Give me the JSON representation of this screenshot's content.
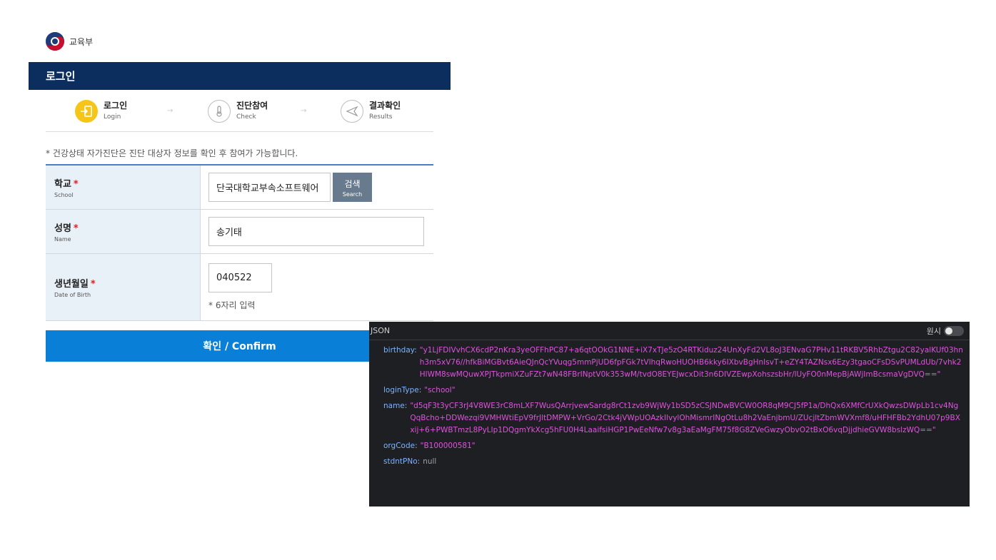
{
  "ministry": {
    "name": "교육부"
  },
  "header": {
    "title": "로그인"
  },
  "steps": [
    {
      "label": "로그인",
      "sub": "Login",
      "icon": "login-icon",
      "active": true
    },
    {
      "label": "진단참여",
      "sub": "Check",
      "icon": "thermometer-icon",
      "active": false
    },
    {
      "label": "결과확인",
      "sub": "Results",
      "icon": "send-icon",
      "active": false
    }
  ],
  "step_arrow": "→",
  "notice": "* 건강상태 자가진단은 진단 대상자 정보를 확인 후 참여가 가능합니다.",
  "form": {
    "school": {
      "label": "학교",
      "sub": "School",
      "required": "*",
      "value": "단국대학교부속소프트웨어"
    },
    "search_button": {
      "label": "검색",
      "sub": "Search"
    },
    "name": {
      "label": "성명",
      "sub": "Name",
      "required": "*",
      "value": "송기태"
    },
    "birth": {
      "label": "생년월일",
      "sub": "Date of Birth",
      "required": "*",
      "value": "040522",
      "hint": "* 6자리 입력"
    }
  },
  "confirm_button": "확인 / Confirm",
  "devtools": {
    "title": "JSON",
    "raw_label": "원시",
    "raw_enabled": false,
    "fields": [
      {
        "key": "birthday:",
        "value": "\"y1LjFDIVvhCX6cdP2nKra3yeOFFhPC87+a6qtOOkG1NNE+iX7xTJe5zO4RTKiduz24UnXyFd2VL8oJ3ENvaG7PHv11tRKBV5RhbZtgu2C82yalKUf03hnh3m5xV76//hfkBiMGBvt6AieQJnQcYVuqg5mmPjUD6fpFGk7tVlhqRwoHUOHB6kky6IXbvBgHnIsvT+eZY4TAZNsx6Ezy3tgaoCFsDSvPUMLdUb/7vhk2HlWM8swMQuwXPJTkpmiXZuFZt7wN48FBrINptV0k353wM/tvdO8EYEJwcxDit3n6DIVZEwpXohszsbHr/lUyFO0nMepBjAWjImBcsmaVgDVQ==\""
      },
      {
        "key": "loginType:",
        "value": "\"school\""
      },
      {
        "key": "name:",
        "value": "\"d5qF3t3yCF3rJ4V8WE3rC8mLXF7WusQArrjvewSardg8rCt1zvb9WjWy1bSD5zCSJNDwBVCW0OR8qM9CJ5fP1a/DhQx6XMfCrUXkQwzsDWpLb1cv4NgQqBcho+DDWezqi9VMHWtiEpV9frJltDMPW+VrGo/2Ctk4jVWpUOAzkIlvylOhMismrINgOtLu8h2VaEnjbmU/ZUcjltZbmWVXmf8/uHFHFBb2YdhU07p9BXxij+6+PWBTmzL8PyLlp1DQgmYkXcg5hFU0H4LaaifsiHGP1PwEeNfw7v8g3aEaMgFM75f8G8ZVeGwzyObvO2tBxO6vqDjjdhieGVW8bslzWQ==\""
      },
      {
        "key": "orgCode:",
        "value": "\"B100000581\""
      },
      {
        "key": "stdntPNo:",
        "value": "null"
      }
    ]
  }
}
